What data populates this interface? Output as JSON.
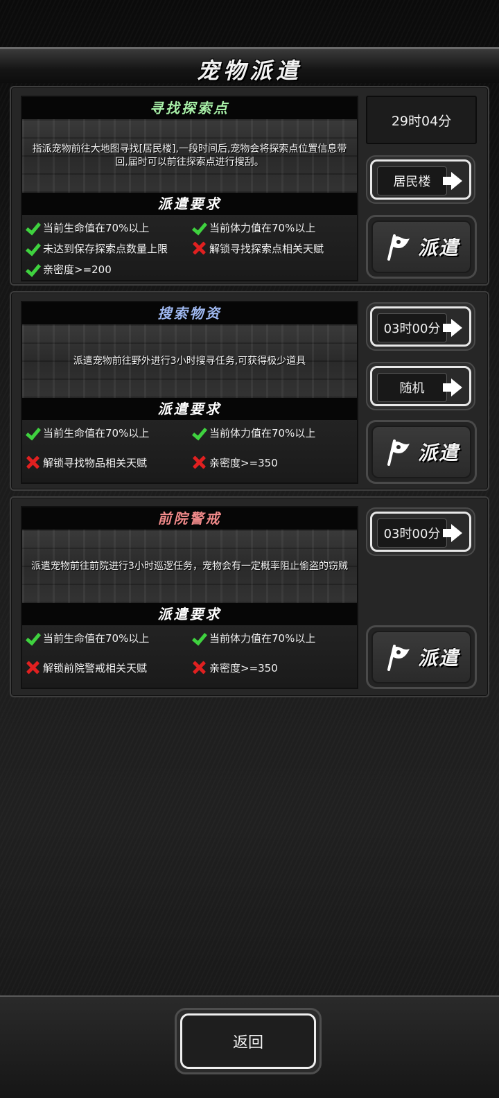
{
  "page_title": "宠物派遣",
  "missions": [
    {
      "title": "寻找探索点",
      "title_color": "#a8f0a8",
      "description": "指派宠物前往大地图寻找[居民楼],一段时间后,宠物会将探索点位置信息带回,届时可以前往探索点进行搜刮。",
      "requirements_title": "派遣要求",
      "requirements": [
        {
          "text": "当前生命值在70%以上",
          "met": true
        },
        {
          "text": "当前体力值在70%以上",
          "met": true
        },
        {
          "text": "未达到保存探索点数量上限",
          "met": true
        },
        {
          "text": "解锁寻找探索点相关天赋",
          "met": false
        },
        {
          "text": "亲密度>=200",
          "met": true
        }
      ],
      "time": "29时04分",
      "target": "居民楼",
      "dispatch_label": "派遣"
    },
    {
      "title": "搜索物资",
      "title_color": "#9fb8f0",
      "description": "派遣宠物前往野外进行3小时搜寻任务,可获得极少道具",
      "requirements_title": "派遣要求",
      "requirements": [
        {
          "text": "当前生命值在70%以上",
          "met": true
        },
        {
          "text": "当前体力值在70%以上",
          "met": true
        },
        {
          "text": "解锁寻找物品相关天赋",
          "met": false
        },
        {
          "text": "亲密度>=350",
          "met": false
        }
      ],
      "time": "03时00分",
      "target": "随机",
      "dispatch_label": "派遣"
    },
    {
      "title": "前院警戒",
      "title_color": "#f08a8a",
      "description": "派遣宠物前往前院进行3小时巡逻任务，宠物会有一定概率阻止偷盗的窃贼",
      "requirements_title": "派遣要求",
      "requirements": [
        {
          "text": "当前生命值在70%以上",
          "met": true
        },
        {
          "text": "当前体力值在70%以上",
          "met": true
        },
        {
          "text": "解锁前院警戒相关天赋",
          "met": false
        },
        {
          "text": "亲密度>=350",
          "met": false
        }
      ],
      "time": "03时00分",
      "dispatch_label": "派遣"
    }
  ],
  "back_label": "返回",
  "icons": {
    "check": "check-icon",
    "cross": "cross-icon",
    "arrow": "arrow-right-icon",
    "flag": "flag-icon"
  }
}
